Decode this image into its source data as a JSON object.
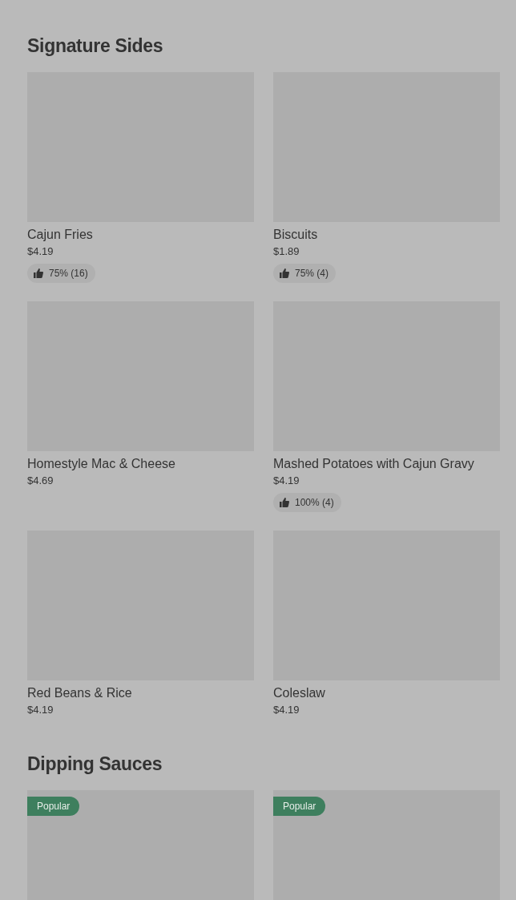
{
  "sections": [
    {
      "title": "Signature Sides",
      "items": [
        {
          "name": "Cajun Fries",
          "price": "$4.19",
          "rating": "75% (16)"
        },
        {
          "name": "Biscuits",
          "price": "$1.89",
          "rating": "75% (4)"
        },
        {
          "name": "Homestyle Mac & Cheese",
          "price": "$4.69"
        },
        {
          "name": "Mashed Potatoes with Cajun Gravy",
          "price": "$4.19",
          "rating": "100% (4)"
        },
        {
          "name": "Red Beans & Rice",
          "price": "$4.19"
        },
        {
          "name": "Coleslaw",
          "price": "$4.19"
        }
      ]
    },
    {
      "title": "Dipping Sauces",
      "items": [
        {
          "badge": "Popular"
        },
        {
          "badge": "Popular"
        }
      ]
    }
  ]
}
